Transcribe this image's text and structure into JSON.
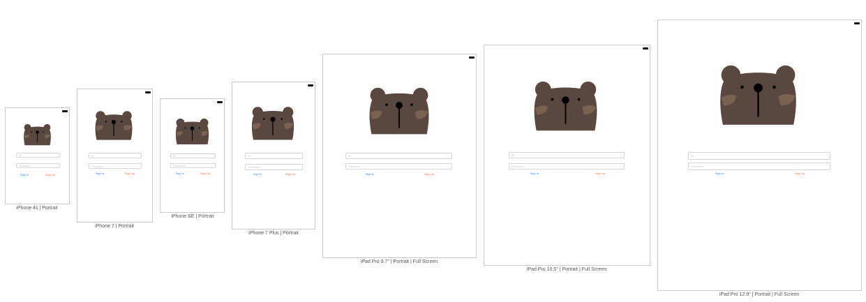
{
  "colors": {
    "bear_fur": "#5a4740",
    "bear_cheeks": "#7a6150",
    "bear_features": "#000000",
    "sign_in": "#2f8cff",
    "sign_up": "#ff6f4a",
    "device_border": "#c9c9c9"
  },
  "devices": [
    {
      "caption": "iPhone 4s | Portrait",
      "id_placeholder": "ID",
      "password_placeholder": "Password",
      "sign_in_label": "Sign In",
      "sign_up_label": "Sign Up"
    },
    {
      "caption": "iPhone 7 | Portrait",
      "id_placeholder": "ID",
      "password_placeholder": "Password",
      "sign_in_label": "Sign In",
      "sign_up_label": "Sign Up"
    },
    {
      "caption": "iPhone SE | Portrait",
      "id_placeholder": "ID",
      "password_placeholder": "Password",
      "sign_in_label": "Sign In",
      "sign_up_label": "Sign Up"
    },
    {
      "caption": "iPhone 7 Plus | Portrait",
      "id_placeholder": "ID",
      "password_placeholder": "Password",
      "sign_in_label": "Sign In",
      "sign_up_label": "Sign Up"
    },
    {
      "caption": "iPad Pro 9.7\" | Portrait | Full Screen",
      "id_placeholder": "ID",
      "password_placeholder": "Password",
      "sign_in_label": "Sign In",
      "sign_up_label": "Sign Up"
    },
    {
      "caption": "iPad Pro 10.5\" | Portrait | Full Screen",
      "id_placeholder": "ID",
      "password_placeholder": "Password",
      "sign_in_label": "Sign In",
      "sign_up_label": "Sign Up"
    },
    {
      "caption": "iPad Pro 12.9\" | Portrait | Full Screen",
      "id_placeholder": "ID",
      "password_placeholder": "Password",
      "sign_in_label": "Sign In",
      "sign_up_label": "Sign Up"
    }
  ]
}
